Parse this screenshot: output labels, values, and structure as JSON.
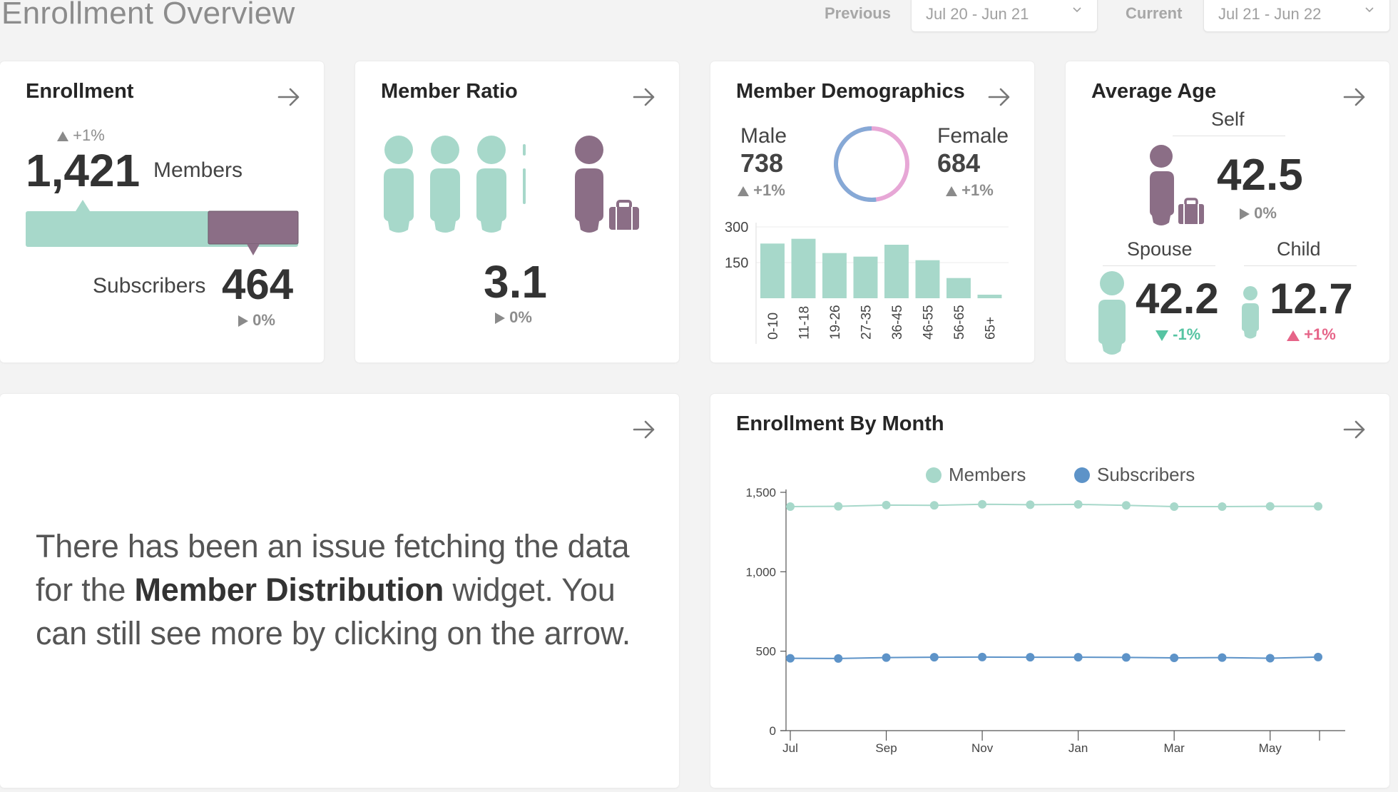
{
  "header": {
    "title": "Enrollment Overview",
    "previous_label": "Previous",
    "previous_value": "Jul 20 - Jun 21",
    "current_label": "Current",
    "current_value": "Jul 21 - Jun 22"
  },
  "colors": {
    "members": "#a7d8ca",
    "subscribers": "#5d93c8",
    "member_figure": "#a7d8ca",
    "subscriber_figure": "#8b6e86",
    "male_ring": "#86a9d6",
    "female_ring": "#e7a7d6",
    "positive_change": "#56c4a2",
    "negative_change": "#e66488"
  },
  "enrollment": {
    "title": "Enrollment",
    "members_change": "+1%",
    "members_value": "1,421",
    "members_label": "Members",
    "subscribers_label": "Subscribers",
    "subscribers_value": "464",
    "subscribers_change": "0%",
    "subscriber_share": 0.33
  },
  "member_ratio": {
    "title": "Member Ratio",
    "value": "3.1",
    "change": "0%"
  },
  "demographics": {
    "title": "Member Demographics",
    "male_label": "Male",
    "male_value": "738",
    "male_change": "+1%",
    "female_label": "Female",
    "female_value": "684",
    "female_change": "+1%",
    "male_share": 0.52,
    "age_axis": {
      "ticks": [
        "300",
        "150"
      ]
    },
    "age_groups": [
      "0-10",
      "11-18",
      "19-26",
      "27-35",
      "36-45",
      "46-55",
      "56-65",
      "65+"
    ],
    "age_values": [
      230,
      250,
      190,
      175,
      225,
      160,
      85,
      15
    ]
  },
  "average_age": {
    "title": "Average Age",
    "self_label": "Self",
    "self_value": "42.5",
    "self_change": "0%",
    "spouse_label": "Spouse",
    "spouse_value": "42.2",
    "spouse_change": "-1%",
    "child_label": "Child",
    "child_value": "12.7",
    "child_change": "+1%"
  },
  "distribution_error": {
    "line1": "There has been an issue fetching the data",
    "line2_pre": "for the ",
    "line2_bold": "Member Distribution",
    "line2_post": " widget. You",
    "line3": "can still see more by clicking on the arrow."
  },
  "chart_data": {
    "type": "line",
    "title": "Enrollment By Month",
    "legend": [
      "Members",
      "Subscribers"
    ],
    "x": [
      "Jul",
      "Aug",
      "Sep",
      "Oct",
      "Nov",
      "Dec",
      "Jan",
      "Feb",
      "Mar",
      "Apr",
      "May",
      "Jun"
    ],
    "x_tick_labels": [
      "Jul",
      "Sep",
      "Nov",
      "Jan",
      "Mar",
      "May"
    ],
    "y_ticks": [
      "0",
      "500",
      "1,000",
      "1,500"
    ],
    "ylim": [
      0,
      1500
    ],
    "series": [
      {
        "name": "Members",
        "values": [
          1410,
          1412,
          1420,
          1418,
          1425,
          1422,
          1424,
          1418,
          1410,
          1410,
          1412,
          1412
        ]
      },
      {
        "name": "Subscribers",
        "values": [
          455,
          454,
          460,
          462,
          463,
          462,
          462,
          461,
          458,
          460,
          456,
          463
        ]
      }
    ]
  }
}
